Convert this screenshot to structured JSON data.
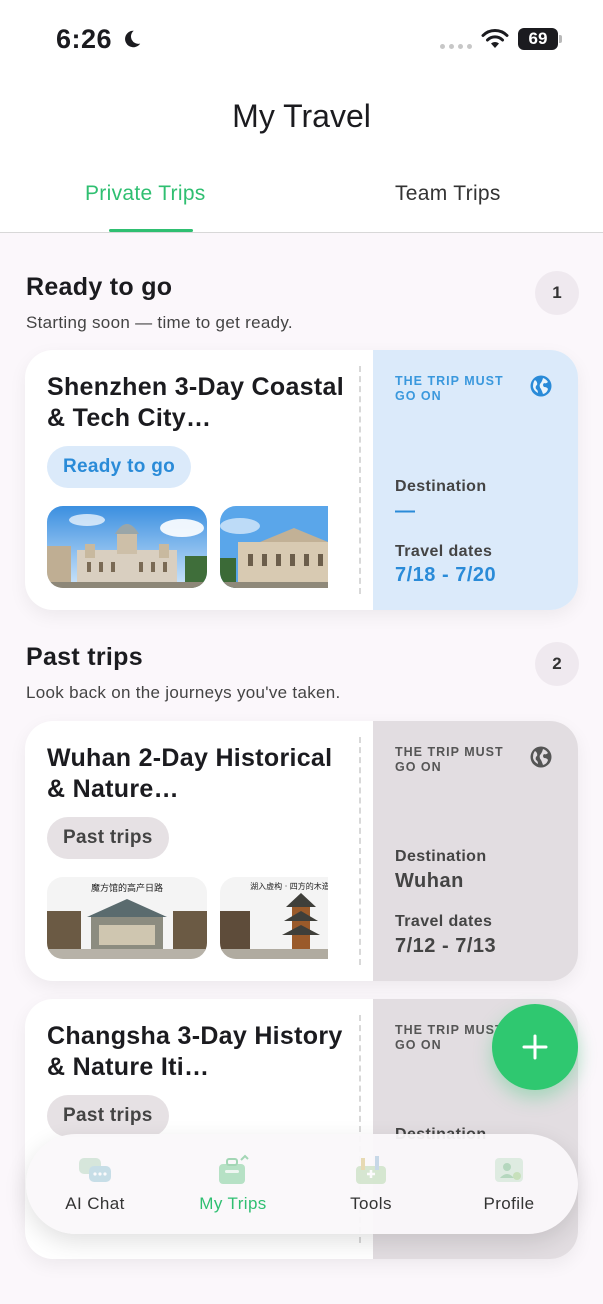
{
  "status_bar": {
    "time": "6:26",
    "battery": "69"
  },
  "header": {
    "title": "My Travel",
    "tabs": [
      {
        "label": "Private Trips",
        "active": true
      },
      {
        "label": "Team Trips",
        "active": false
      }
    ]
  },
  "sections": {
    "ready": {
      "title": "Ready to go",
      "subtitle": "Starting soon — time to get ready.",
      "count": "1"
    },
    "past": {
      "title": "Past trips",
      "subtitle": "Look back on the journeys you've taken.",
      "count": "2"
    }
  },
  "trips": [
    {
      "name": "Shenzhen 3-Day Coastal & Tech City…",
      "status": "Ready to go",
      "tag": "THE TRIP MUST GO ON",
      "destination_label": "Destination",
      "destination": "—",
      "dates_label": "Travel dates",
      "dates": "7/18 - 7/20",
      "accent": "#2a8bd8"
    },
    {
      "name": "Wuhan 2-Day Historical & Nature…",
      "status": "Past trips",
      "tag": "THE TRIP MUST GO ON",
      "destination_label": "Destination",
      "destination": "Wuhan",
      "dates_label": "Travel dates",
      "dates": "7/12 - 7/13",
      "photo_captions": [
        "魔方馆的高产日路",
        "湖入虚构 · 四方的木造"
      ]
    },
    {
      "name": "Changsha 3-Day History & Nature Iti…",
      "status": "Past trips",
      "tag": "THE TRIP MUST GO ON",
      "destination_label": "Destination"
    }
  ],
  "bottom_nav": [
    {
      "label": "AI Chat",
      "icon": "chat-bubbles-icon",
      "active": false
    },
    {
      "label": "My Trips",
      "icon": "suitcase-icon",
      "active": true
    },
    {
      "label": "Tools",
      "icon": "toolbox-icon",
      "active": false
    },
    {
      "label": "Profile",
      "icon": "profile-card-icon",
      "active": false
    }
  ],
  "fab": {
    "icon": "plus-icon"
  },
  "colors": {
    "accent_green": "#2fbf71",
    "accent_blue": "#2a8bd8",
    "fab_green": "#2fc870"
  }
}
